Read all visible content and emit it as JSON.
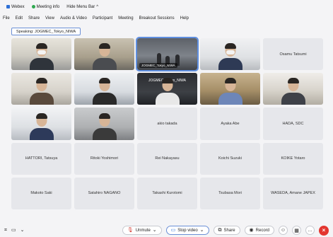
{
  "topbar": {
    "webex_label": "Webex",
    "meeting_info_label": "Meeting info",
    "hide_menu_bar_label": "Hide Menu Bar",
    "hide_menu_caret": "^"
  },
  "menu": [
    "File",
    "Edit",
    "Share",
    "View",
    "Audio & Video",
    "Participant",
    "Meeting",
    "Breakout Sessions",
    "Help"
  ],
  "speaking": "Speaking: JOGMEC_Tokyo_NIWA",
  "tiles": {
    "r1c3_caption": "JOGMEC_Tokyo_NIWA",
    "r1c5_name": "Osamu Tatsumi",
    "r2c3_label": "JOGMEC_Tokyo_NIWA",
    "r3c3_name": "akio takada",
    "r3c4_name": "Ayaka Abe",
    "r3c5_name": "HADA, SDC",
    "r4c1_name": "HATTORI, Tatsuya",
    "r4c2_name": "Ritoki Yoshimori",
    "r4c3_name": "Rei Nakayasu",
    "r4c4_name": "Koichi Suzuki",
    "r4c5_name": "KOIKE Yotaro",
    "r5c1_name": "Makoto Saki",
    "r5c2_name": "Satahiro NAGANO",
    "r5c3_name": "Takashi Kurotomi",
    "r5c4_name": "Tsubasa Mori",
    "r5c5_name": "WASEDA, Amane JAPEX"
  },
  "toolbar": {
    "unmute_label": "Unmute",
    "stop_video_label": "Stop video",
    "share_label": "Share",
    "record_label": "Record",
    "more_label": "...",
    "end_label": "×"
  }
}
